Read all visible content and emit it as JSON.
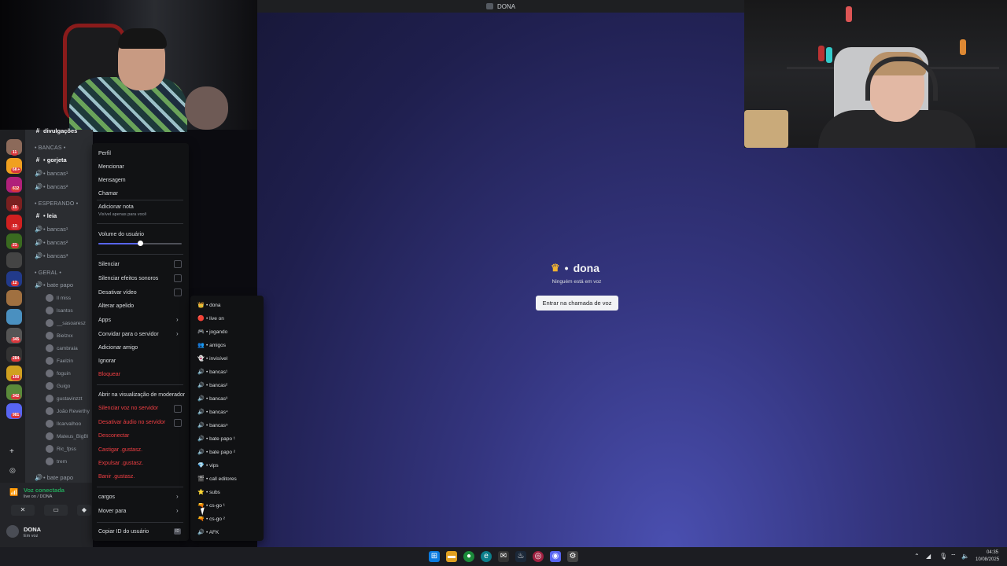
{
  "window": {
    "title": "DONA"
  },
  "voice_stage": {
    "channel_icon": "crown-icon",
    "channel_prefix": "•",
    "channel_name": "dona",
    "empty_text": "Ninguém está em voz",
    "join_label": "Entrar na chamada de voz"
  },
  "sidebar": {
    "top_channel": "divulgações",
    "categories": [
      "• BANCAS •",
      "• ESPERANDO •",
      "• GERAL •"
    ],
    "channels": [
      {
        "name": "• gorjeta",
        "icon": "#"
      },
      {
        "name": "• bancas¹",
        "icon": "🔊"
      },
      {
        "name": "• bancas²",
        "icon": "🔊"
      },
      {
        "name": "• leia",
        "icon": "#"
      },
      {
        "name": "• bancas¹",
        "icon": "🔊"
      },
      {
        "name": "• bancas²",
        "icon": "🔊"
      },
      {
        "name": "• bancas³",
        "icon": "🔊"
      },
      {
        "name": "• bate papo",
        "icon": "🔊"
      },
      {
        "name": "• bate papo",
        "icon": "🔊"
      }
    ],
    "members": [
      "ll miss",
      "lsantos",
      "__sasoaresz",
      "Bielzxx",
      "cambraia",
      "Faelzin",
      "foguin",
      "Guigo",
      "gustavinzzt",
      "João Reverthy",
      "llcarvalhoo",
      "Mateus_BigBl",
      "Ric_fpss",
      "trem"
    ],
    "server_badges": [
      "11",
      "6K+",
      "612",
      "15",
      "13",
      "21",
      "12",
      "345",
      "284",
      "190",
      "342",
      "981"
    ]
  },
  "voice_connection": {
    "status": "Voz conectada",
    "location": "live on / DONA"
  },
  "user_panel": {
    "name": "DONA",
    "status": "Em voz"
  },
  "context_menu": {
    "items": {
      "profile": "Perfil",
      "mention": "Mencionar",
      "message": "Mensagem",
      "call": "Chamar",
      "add_note": "Adicionar nota",
      "add_note_hint": "Visível apenas para você",
      "user_volume": "Volume do usuário",
      "mute": "Silenciar",
      "mute_sounds": "Silenciar efeitos sonoros",
      "disable_video": "Desativar vídeo",
      "change_nick": "Alterar apelido",
      "apps": "Apps",
      "invite": "Convidar para o servidor",
      "add_friend": "Adicionar amigo",
      "ignore": "Ignorar",
      "block": "Bloquear",
      "mod_view": "Abrir na visualização de moderador",
      "server_mute": "Silenciar voz no servidor",
      "server_deafen": "Desativar áudio no servidor",
      "disconnect": "Desconectar",
      "timeout": "Castigar .gustasz.",
      "kick": "Expulsar .gustasz.",
      "ban": "Banir .gustasz.",
      "roles": "cargos",
      "move_to": "Mover para",
      "copy_id": "Copiar ID do usuário"
    },
    "volume_percent": 50
  },
  "move_submenu": [
    {
      "label": "• dona",
      "icon": "👑"
    },
    {
      "label": "• live on",
      "icon": "🔴"
    },
    {
      "label": "• jogando",
      "icon": "🎮"
    },
    {
      "label": "• amigos",
      "icon": "👥"
    },
    {
      "label": "• invisível",
      "icon": "👻"
    },
    {
      "label": "• bancas¹",
      "icon": "🔊"
    },
    {
      "label": "• bancas²",
      "icon": "🔊"
    },
    {
      "label": "• bancas³",
      "icon": "🔊"
    },
    {
      "label": "• bancas⁴",
      "icon": "🔊"
    },
    {
      "label": "• bancas⁵",
      "icon": "🔊"
    },
    {
      "label": "• bate papo ¹",
      "icon": "🔊"
    },
    {
      "label": "• bate papo ²",
      "icon": "🔊"
    },
    {
      "label": "• vips",
      "icon": "💎"
    },
    {
      "label": "• call editores",
      "icon": "🎬"
    },
    {
      "label": "• subs",
      "icon": "⭐"
    },
    {
      "label": "• cs-go ¹",
      "icon": "🔫"
    },
    {
      "label": "• cs-go ²",
      "icon": "🔫"
    },
    {
      "label": "• AFK",
      "icon": "🔊"
    }
  ],
  "taskbar": {
    "time": "04:35",
    "date": "10/08/2025"
  },
  "colors": {
    "accent": "#5865f2",
    "danger": "#f23f43",
    "connected": "#23a55a"
  }
}
